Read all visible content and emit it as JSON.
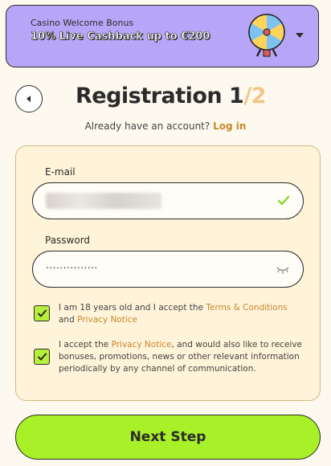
{
  "bonus": {
    "label": "Casino Welcome Bonus",
    "title": "10% Live Cashback up to €200"
  },
  "header": {
    "title": "Registration",
    "step": "1",
    "total": "/2"
  },
  "login": {
    "prompt": "Already have an account?",
    "link": "Log in"
  },
  "form": {
    "email_label": "E-mail",
    "password_label": "Password",
    "password_mask": "...............",
    "terms_pre": "I am 18 years old and I accept the ",
    "terms_link": "Terms & Conditions",
    "terms_mid": " and ",
    "privacy_link": "Privacy Notice",
    "marketing_pre": "I accept the ",
    "marketing_link": "Privacy Notice",
    "marketing_post": ", and would also like to receive bonuses, promotions, news or other relevant information periodically by any channel of communication."
  },
  "next_button": "Next Step",
  "colors": {
    "accent": "#a8f027",
    "link": "#c7882b",
    "banner": "#b7a6f7"
  }
}
